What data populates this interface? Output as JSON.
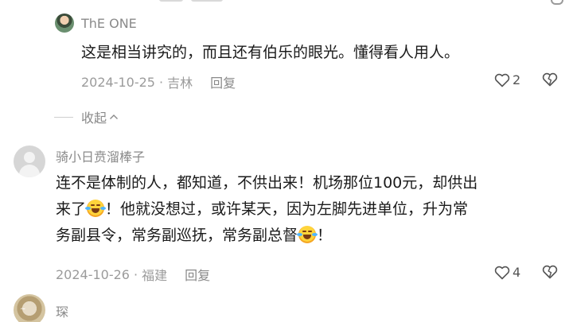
{
  "comments": [
    {
      "user": "ThE ONE",
      "text_lines": [
        "这是相当讲究的，而且还有伯乐的眼光。懂得看人用人。"
      ],
      "date": "2024-10-25",
      "location": "吉林",
      "reply_label": "回复",
      "likes": "2"
    },
    {
      "user": "骑小日贲溜棒子",
      "text_line1": "连不是体制的人，都知道，不供出来！机场那位100元，却供出",
      "text_line2_a": "来了",
      "text_line2_b": "！他就没想过，或许某天，因为左脚先进单位，升为常",
      "text_line3_a": "务副县令，常务副巡抚，常务副总督",
      "text_line3_b": "！",
      "date": "2024-10-26",
      "location": "福建",
      "reply_label": "回复",
      "likes": "4"
    },
    {
      "user": "琛"
    }
  ],
  "collapse_label": "收起",
  "icons": {
    "like": "heart-outline-icon",
    "dislike": "broken-heart-icon",
    "emoji": "laughing-tears-emoji",
    "collapse": "chevron-up-icon"
  }
}
